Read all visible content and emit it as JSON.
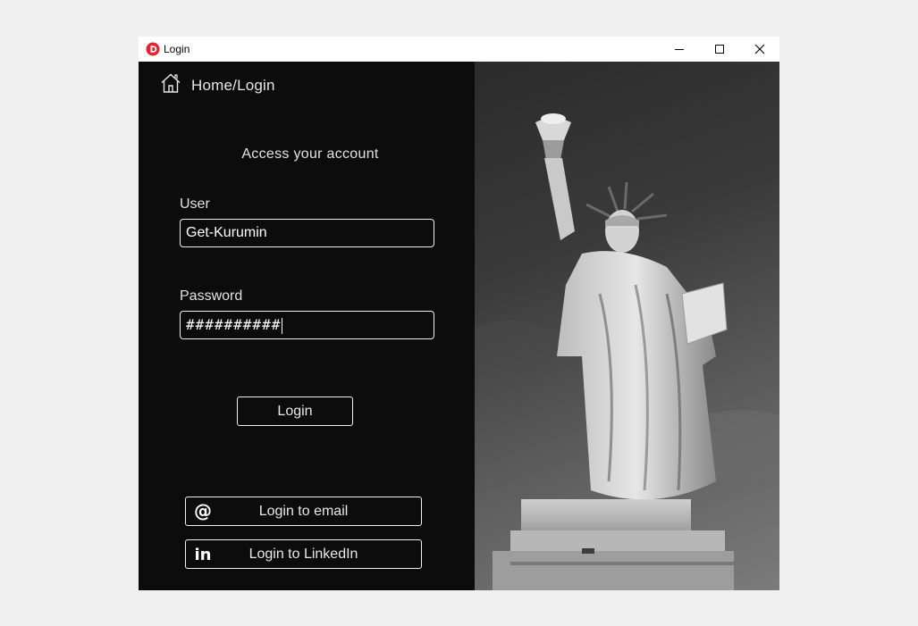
{
  "window": {
    "title": "Login",
    "app_icon_color": "#e8212e"
  },
  "breadcrumb": "Home/Login",
  "form": {
    "heading": "Access your account",
    "user_label": "User",
    "user_value": "Get-Kurumin",
    "password_label": "Password",
    "password_value": "##########",
    "login_button": "Login"
  },
  "social": {
    "email_label": "Login to email",
    "email_icon": "at-icon",
    "linkedin_label": "Login to LinkedIn",
    "linkedin_icon": "linkedin-icon",
    "at_glyph": "@",
    "linkedin_glyph": "in"
  },
  "image": {
    "subject": "statue-of-liberty-photo"
  },
  "colors": {
    "panel_bg": "#0c0c0c",
    "page_bg": "#f0f0f0",
    "text": "#e8e8e8"
  }
}
